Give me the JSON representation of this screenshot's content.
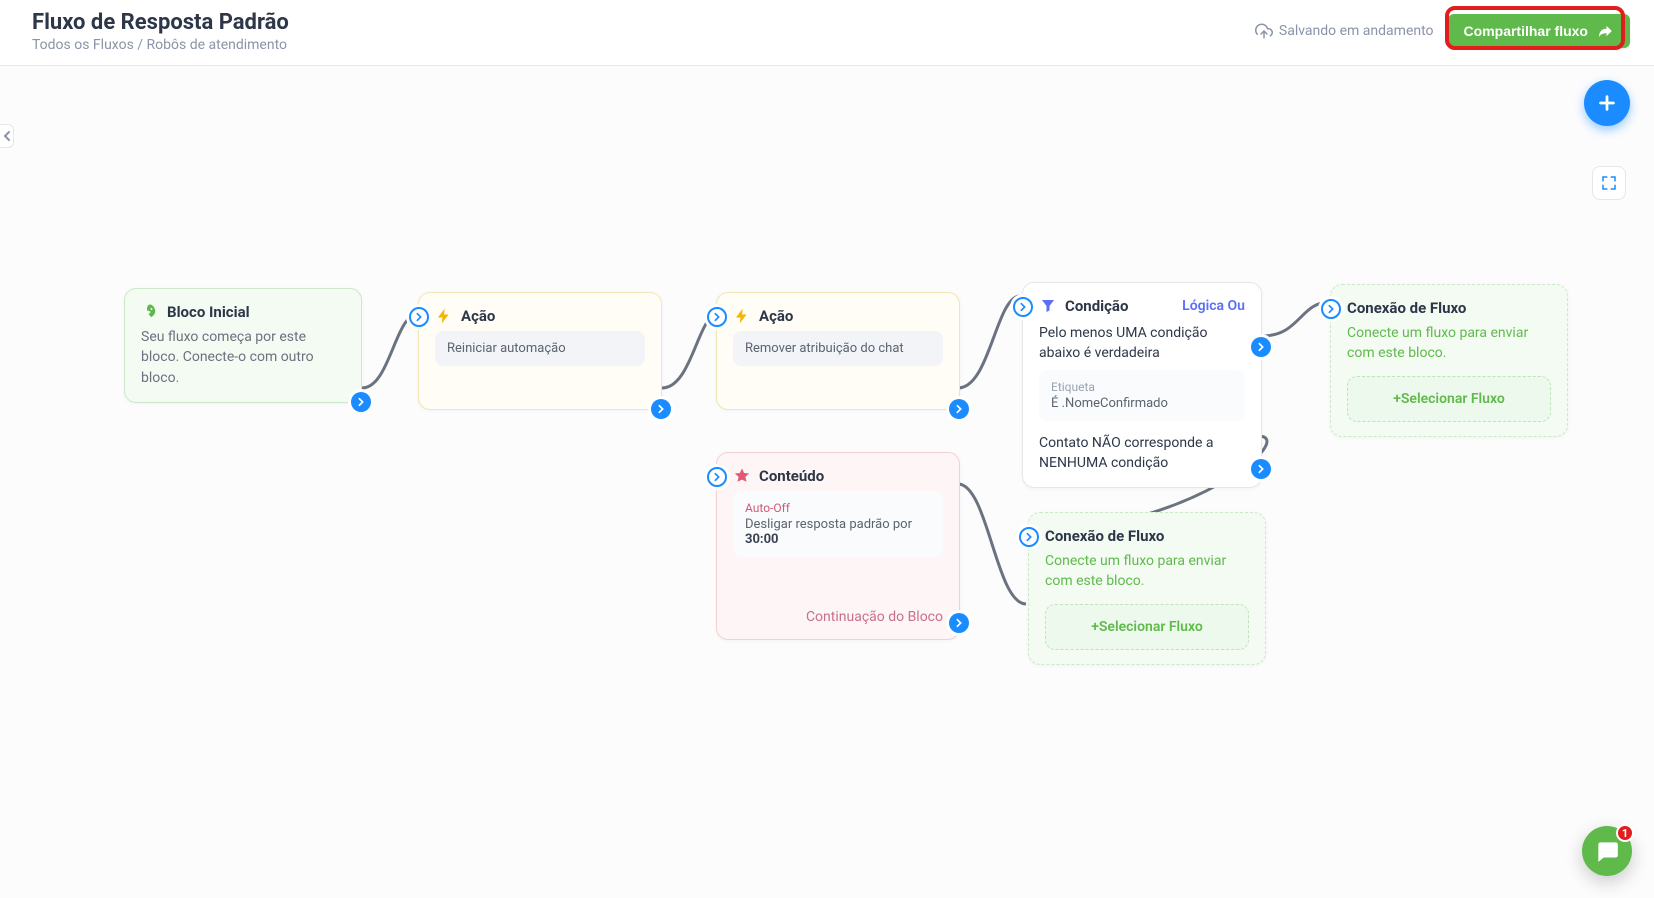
{
  "header": {
    "title": "Fluxo de Resposta Padrão",
    "breadcrumb": {
      "root": "Todos os Fluxos",
      "sep": " / ",
      "current": "Robôs de atendimento"
    },
    "save_status": "Salvando em andamento",
    "share_label": "Compartilhar fluxo"
  },
  "chat": {
    "badge": "1"
  },
  "nodes": {
    "start": {
      "title": "Bloco Inicial",
      "desc": "Seu fluxo começa por este bloco. Conecte-o com outro bloco."
    },
    "action1": {
      "title": "Ação",
      "chip": "Reiniciar automação"
    },
    "action2": {
      "title": "Ação",
      "chip": "Remover atribuição do chat"
    },
    "content": {
      "title": "Conteúdo",
      "auto_off_label": "Auto-Off",
      "auto_off_desc_pre": "Desligar resposta padrão por ",
      "auto_off_value": "30:00",
      "continuation": "Continuação do Bloco"
    },
    "condition": {
      "title": "Condição",
      "logic": "Lógica Ou",
      "sentence": "Pelo menos UMA condição abaixo é verdadeira",
      "tag_label": "Etiqueta",
      "tag_value": "É .NomeConfirmado",
      "else": "Contato NÃO corresponde a NENHUMA condição"
    },
    "conn1": {
      "title": "Conexão de Fluxo",
      "desc": "Conecte um fluxo para enviar com este bloco.",
      "btn": "+Selecionar Fluxo"
    },
    "conn2": {
      "title": "Conexão de Fluxo",
      "desc": "Conecte um fluxo para enviar com este bloco.",
      "btn": "+Selecionar Fluxo"
    }
  }
}
